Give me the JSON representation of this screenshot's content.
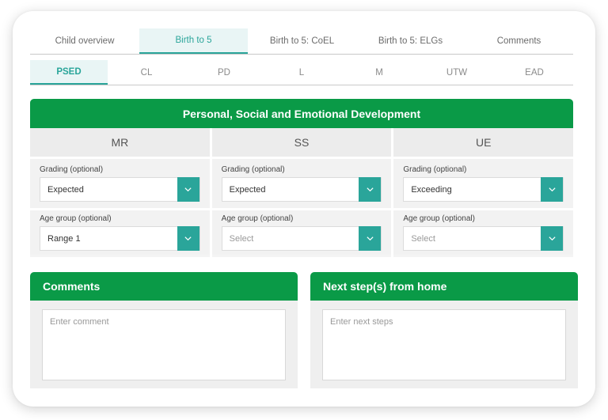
{
  "tabs_primary": [
    "Child overview",
    "Birth to 5",
    "Birth to 5: CoEL",
    "Birth to 5: ELGs",
    "Comments"
  ],
  "tabs_secondary": [
    "PSED",
    "CL",
    "PD",
    "L",
    "M",
    "UTW",
    "EAD"
  ],
  "panel": {
    "title": "Personal, Social and Emotional Development",
    "columns": [
      {
        "name": "MR",
        "grading_label": "Grading (optional)",
        "grading_value": "Expected",
        "age_label": "Age group (optional)",
        "age_value": "Range 1"
      },
      {
        "name": "SS",
        "grading_label": "Grading (optional)",
        "grading_value": "Expected",
        "age_label": "Age group (optional)",
        "age_value": "Select"
      },
      {
        "name": "UE",
        "grading_label": "Grading (optional)",
        "grading_value": "Exceeding",
        "age_label": "Age group (optional)",
        "age_value": "Select"
      }
    ]
  },
  "comments": {
    "title": "Comments",
    "placeholder": "Enter comment"
  },
  "next_steps": {
    "title": "Next step(s) from home",
    "placeholder": "Enter next steps"
  },
  "colors": {
    "green": "#0a9a47",
    "teal": "#2aa59a"
  }
}
